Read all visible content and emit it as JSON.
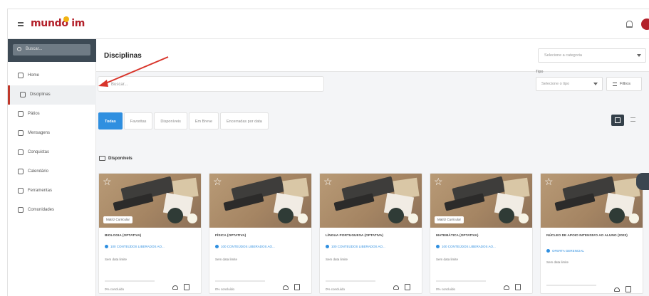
{
  "brand": {
    "logo_text": "mundo im",
    "accent": "#b3202a",
    "logo_dot": "#f2b312"
  },
  "sidebar": {
    "search_placeholder": "Buscar...",
    "items": [
      {
        "label": "Home",
        "icon": "home-icon",
        "active": false
      },
      {
        "label": "Disciplinas",
        "icon": "books-icon",
        "active": true
      },
      {
        "label": "Pátios",
        "icon": "people-icon",
        "active": false
      },
      {
        "label": "Mensagens",
        "icon": "message-icon",
        "active": false
      },
      {
        "label": "Conquistas",
        "icon": "trophy-icon",
        "active": false
      },
      {
        "label": "Calendário",
        "icon": "calendar-icon",
        "active": false
      },
      {
        "label": "Ferramentas",
        "icon": "tools-icon",
        "active": false
      },
      {
        "label": "Comunidades",
        "icon": "community-icon",
        "active": false
      }
    ]
  },
  "header": {
    "title": "Disciplinas",
    "category_select": "Selecione a categoria"
  },
  "search": {
    "placeholder": "Buscar..."
  },
  "type_filter": {
    "label": "Tipo",
    "placeholder": "Selecione o tipo",
    "filter_button": "Filtros"
  },
  "tabs": [
    {
      "label": "Todas",
      "active": true
    },
    {
      "label": "Favoritas",
      "active": false
    },
    {
      "label": "Disponíveis",
      "active": false
    },
    {
      "label": "Em Breve",
      "active": false
    },
    {
      "label": "Encerradas por data",
      "active": false
    }
  ],
  "section": {
    "title": "Disponíveis"
  },
  "cards": [
    {
      "tag": "Matriz Curricular",
      "title": "BIOLOGIA (OPTATIVA)",
      "meta": "100 CONTEÚDOS LIBERADOS AO...",
      "date": "Sem data limite",
      "progress_pct": 0,
      "progress_label": "0% concluído"
    },
    {
      "tag": "",
      "title": "FÍSICA (OPTATIVA)",
      "meta": "100 CONTEÚDOS LIBERADOS AO...",
      "date": "Sem data limite",
      "progress_pct": 0,
      "progress_label": "0% concluído"
    },
    {
      "tag": "",
      "title": "LÍNGUA PORTUGUESA (OPTATIVA)",
      "meta": "100 CONTEÚDOS LIBERADOS AO...",
      "date": "Sem data limite",
      "progress_pct": 0,
      "progress_label": "0% concluído"
    },
    {
      "tag": "Matriz Curricular",
      "title": "MATEMÁTICA (OPTATIVA)",
      "meta": "100 CONTEÚDOS LIBERADOS AO...",
      "date": "Sem data limite",
      "progress_pct": 0,
      "progress_label": "0% concluído"
    },
    {
      "tag": "",
      "title": "NÚCLEO DE APOIO INTENSIVO AO ALUNO (2023)",
      "meta": "OFERTA GERENCIAL",
      "date": "Sem data limite",
      "progress_pct": 0,
      "progress_label": "0% concluído"
    }
  ],
  "colors": {
    "tab_active": "#2f8fe0",
    "annotation_arrow": "#d8342a",
    "sidebar_dark": "#3d4a55"
  }
}
